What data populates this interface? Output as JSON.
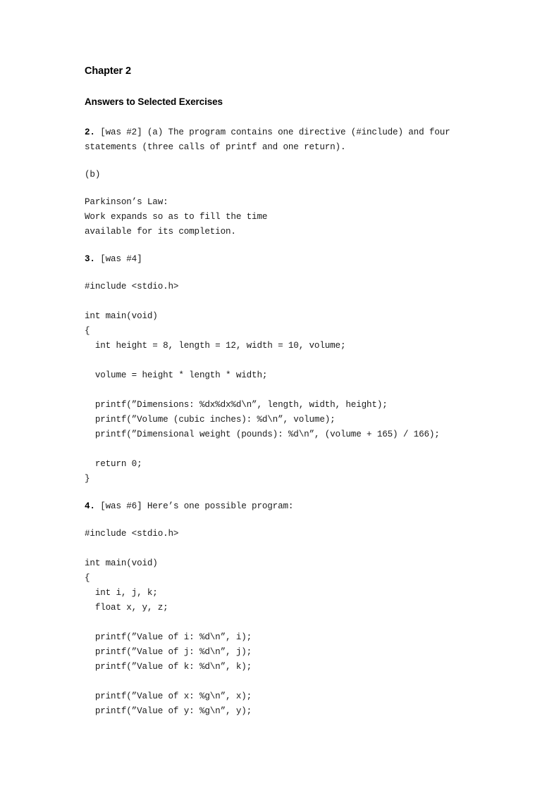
{
  "document": {
    "chapter_heading": "Chapter 2",
    "section_heading": "Answers to Selected Exercises"
  },
  "exercise_2": {
    "number": "2.",
    "body": " [was #2] (a) The program contains one directive (#include) and four statements (three calls of printf and one return).",
    "part_b_label": "(b)",
    "quote": "Parkinson’s Law:\nWork expands so as to fill the time\navailable for its completion."
  },
  "exercise_3": {
    "number": "3.",
    "body": " [was #4]",
    "code": "#include <stdio.h>\n\nint main(void)\n{\n  int height = 8, length = 12, width = 10, volume;\n\n  volume = height * length * width;\n\n  printf(”Dimensions: %dx%dx%d\\n”, length, width, height);\n  printf(”Volume (cubic inches): %d\\n”, volume);\n  printf(”Dimensional weight (pounds): %d\\n”, (volume + 165) / 166);\n\n  return 0;\n}"
  },
  "exercise_4": {
    "number": "4.",
    "body": " [was #6] Here’s one possible program:",
    "code": "#include <stdio.h>\n\nint main(void)\n{\n  int i, j, k;\n  float x, y, z;\n\n  printf(”Value of i: %d\\n”, i);\n  printf(”Value of j: %d\\n”, j);\n  printf(”Value of k: %d\\n”, k);\n\n  printf(”Value of x: %g\\n”, x);\n  printf(”Value of y: %g\\n”, y);"
  }
}
